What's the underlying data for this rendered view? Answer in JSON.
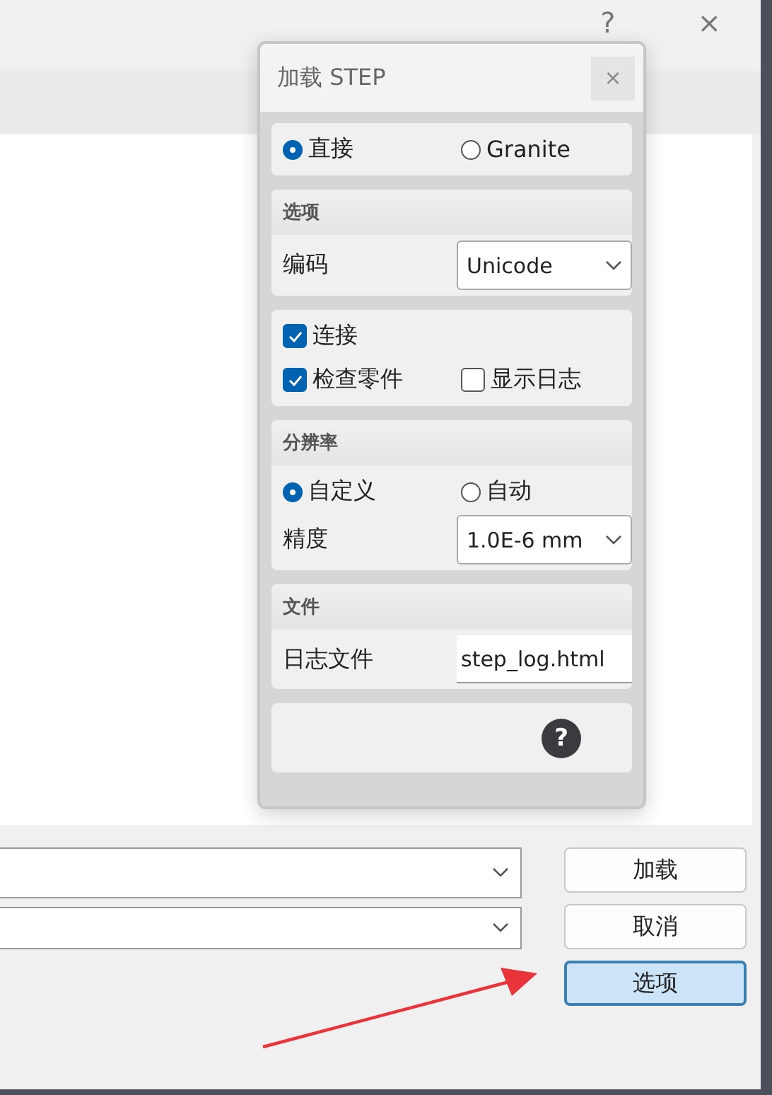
{
  "main_window": {
    "help": "?",
    "close": "×",
    "buttons": [
      {
        "label": "加载",
        "focused": false
      },
      {
        "label": "取消",
        "focused": false
      },
      {
        "label": "选项",
        "focused": true
      }
    ]
  },
  "dialog": {
    "title": "加载 STEP",
    "close": "×",
    "mode": [
      {
        "label": "直接",
        "selected": true
      },
      {
        "label": "Granite",
        "selected": false
      }
    ],
    "options": {
      "header": "选项",
      "encoding": {
        "label": "编码",
        "value": "Unicode"
      }
    },
    "checks": [
      {
        "label": "连接",
        "checked": true
      },
      {
        "label": "检查零件",
        "checked": true
      },
      {
        "label": "显示日志",
        "checked": false
      }
    ],
    "resolution": {
      "header": "分辨率",
      "modes": [
        {
          "label": "自定义",
          "selected": true
        },
        {
          "label": "自动",
          "selected": false
        }
      ],
      "precision": {
        "label": "精度",
        "value": "1.0E-6 mm"
      }
    },
    "file": {
      "header": "文件",
      "log": {
        "label": "日志文件",
        "value": "step_log.html"
      }
    },
    "help": "?"
  }
}
